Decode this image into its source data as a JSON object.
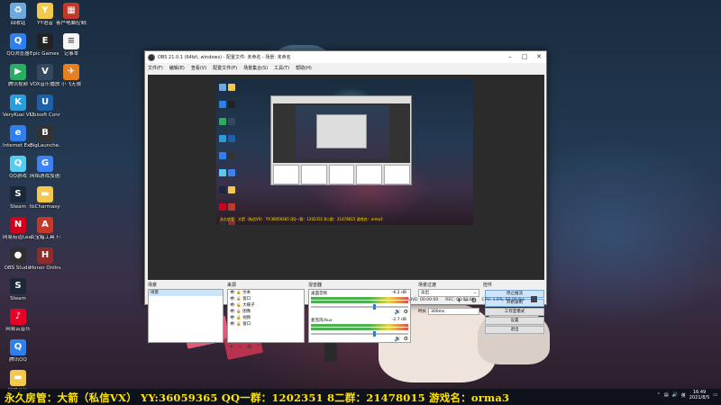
{
  "desktop_icons": [
    {
      "id": "recycle",
      "label": "回收站",
      "color": "#6fa8dc",
      "glyph": "♻"
    },
    {
      "id": "yy",
      "label": "YY语音",
      "color": "#f2c94c",
      "glyph": "Y"
    },
    {
      "id": "shopmgr",
      "label": "客户电脑控制器",
      "color": "#c0392b",
      "glyph": "▦"
    },
    {
      "id": "qqbrowser",
      "label": "QQ浏览器",
      "color": "#2f80ed",
      "glyph": "Q"
    },
    {
      "id": "epic",
      "label": "Epic Games Launcher",
      "color": "#222222",
      "glyph": "E"
    },
    {
      "id": "notepad",
      "label": "记事本",
      "color": "#f5f5f5",
      "glyph": "≡"
    },
    {
      "id": "tencentvideo",
      "label": "腾讯视频",
      "color": "#27ae60",
      "glyph": "▶"
    },
    {
      "id": "vox",
      "label": "VOX音乐播放器",
      "color": "#34495e",
      "glyph": "V"
    },
    {
      "id": "remote",
      "label": "小飞无限",
      "color": "#e67e22",
      "glyph": "✈"
    },
    {
      "id": "virtualvk",
      "label": "VeryKuai VK加速器",
      "color": "#2d9cdb",
      "glyph": "K"
    },
    {
      "id": "ubisoft",
      "label": "Ubisoft Connect",
      "color": "#1d5fa8",
      "glyph": "U"
    },
    {
      "id": "ie",
      "label": "Internet Explorer",
      "color": "#2f80ed",
      "glyph": "e"
    },
    {
      "id": "biglauncher",
      "label": "BigLaunche...",
      "color": "#333333",
      "glyph": "B"
    },
    {
      "id": "qqgame",
      "label": "QQ游戏",
      "color": "#56ccf2",
      "glyph": "Q"
    },
    {
      "id": "netgame",
      "label": "网络游戏加速器",
      "color": "#3b82f6",
      "glyph": "G"
    },
    {
      "id": "steam",
      "label": "Steam",
      "color": "#1b2838",
      "glyph": "S"
    },
    {
      "id": "folder",
      "label": "tbCharmasyo...",
      "color": "#f2c94c",
      "glyph": "▬"
    },
    {
      "id": "netease",
      "label": "网易有道LearnGuide",
      "color": "#d0021b",
      "glyph": "N"
    },
    {
      "id": "aomen",
      "label": "百宝箱工具下载(CVA...",
      "color": "#c0392b",
      "glyph": "A"
    },
    {
      "id": "obs",
      "label": "OBS Studio",
      "color": "#302e31",
      "glyph": "●"
    },
    {
      "id": "honor",
      "label": "Honor Online",
      "color": "#8e2b2b",
      "glyph": "H"
    },
    {
      "id": "steam2",
      "label": "Steam",
      "color": "#1b2838",
      "glyph": "S"
    },
    {
      "id": "cloudmusic",
      "label": "网易云音乐",
      "color": "#e60026",
      "glyph": "♪"
    },
    {
      "id": "ttqq",
      "label": "腾讯QQ",
      "color": "#2f80ed",
      "glyph": "Q"
    },
    {
      "id": "musicbox",
      "label": "网易音乐",
      "color": "#f2c94c",
      "glyph": "▬"
    },
    {
      "id": "netdisk",
      "label": "网易UU加速器",
      "color": "#2d9cdb",
      "glyph": "U"
    },
    {
      "id": "newdoc",
      "label": "新建文本文档.txt",
      "color": "#f5f5f5",
      "glyph": "≡"
    }
  ],
  "obs_window": {
    "title": "OBS 21.0.1 (64bit, windows) - 配置文件: 未命名 - 场景: 未命名",
    "menu": [
      "文件(F)",
      "编辑(E)",
      "查看(V)",
      "配置文件(P)",
      "场景集合(S)",
      "工具(T)",
      "帮助(H)"
    ],
    "scenes_dock": {
      "title": "场景",
      "items": [
        "场景"
      ]
    },
    "sources_dock": {
      "title": "来源",
      "items": [
        "文本",
        "窗口",
        "大碟子",
        "图像",
        "视频",
        "窗口"
      ]
    },
    "mixer_dock": {
      "title": "混音器",
      "channels": [
        {
          "name": "桌面音频",
          "db": "-6.2 dB"
        },
        {
          "name": "麦克风/Aux",
          "db": "-2.7 dB"
        }
      ]
    },
    "transitions_dock": {
      "title": "场景过渡",
      "transition": "淡出",
      "duration_label": "时长",
      "duration_value": "300ms"
    },
    "controls_dock": {
      "title": "控件",
      "buttons": [
        "停止推流",
        "开始录制",
        "工作室模式",
        "设置",
        "退出"
      ]
    },
    "status": {
      "live": "LIVE: 00:00:00",
      "rec": "REC: 00:00:00",
      "cpu": "CPU: 1.0%, 60.00 fps"
    }
  },
  "stream_overlay_text": "永久房管：大箭（私信VX）  YY:36059365 QQ一群：1202351 8二群：21478015  游戏名：orma3",
  "taskbar": {
    "time": "16:49",
    "date": "2021/8/5"
  }
}
